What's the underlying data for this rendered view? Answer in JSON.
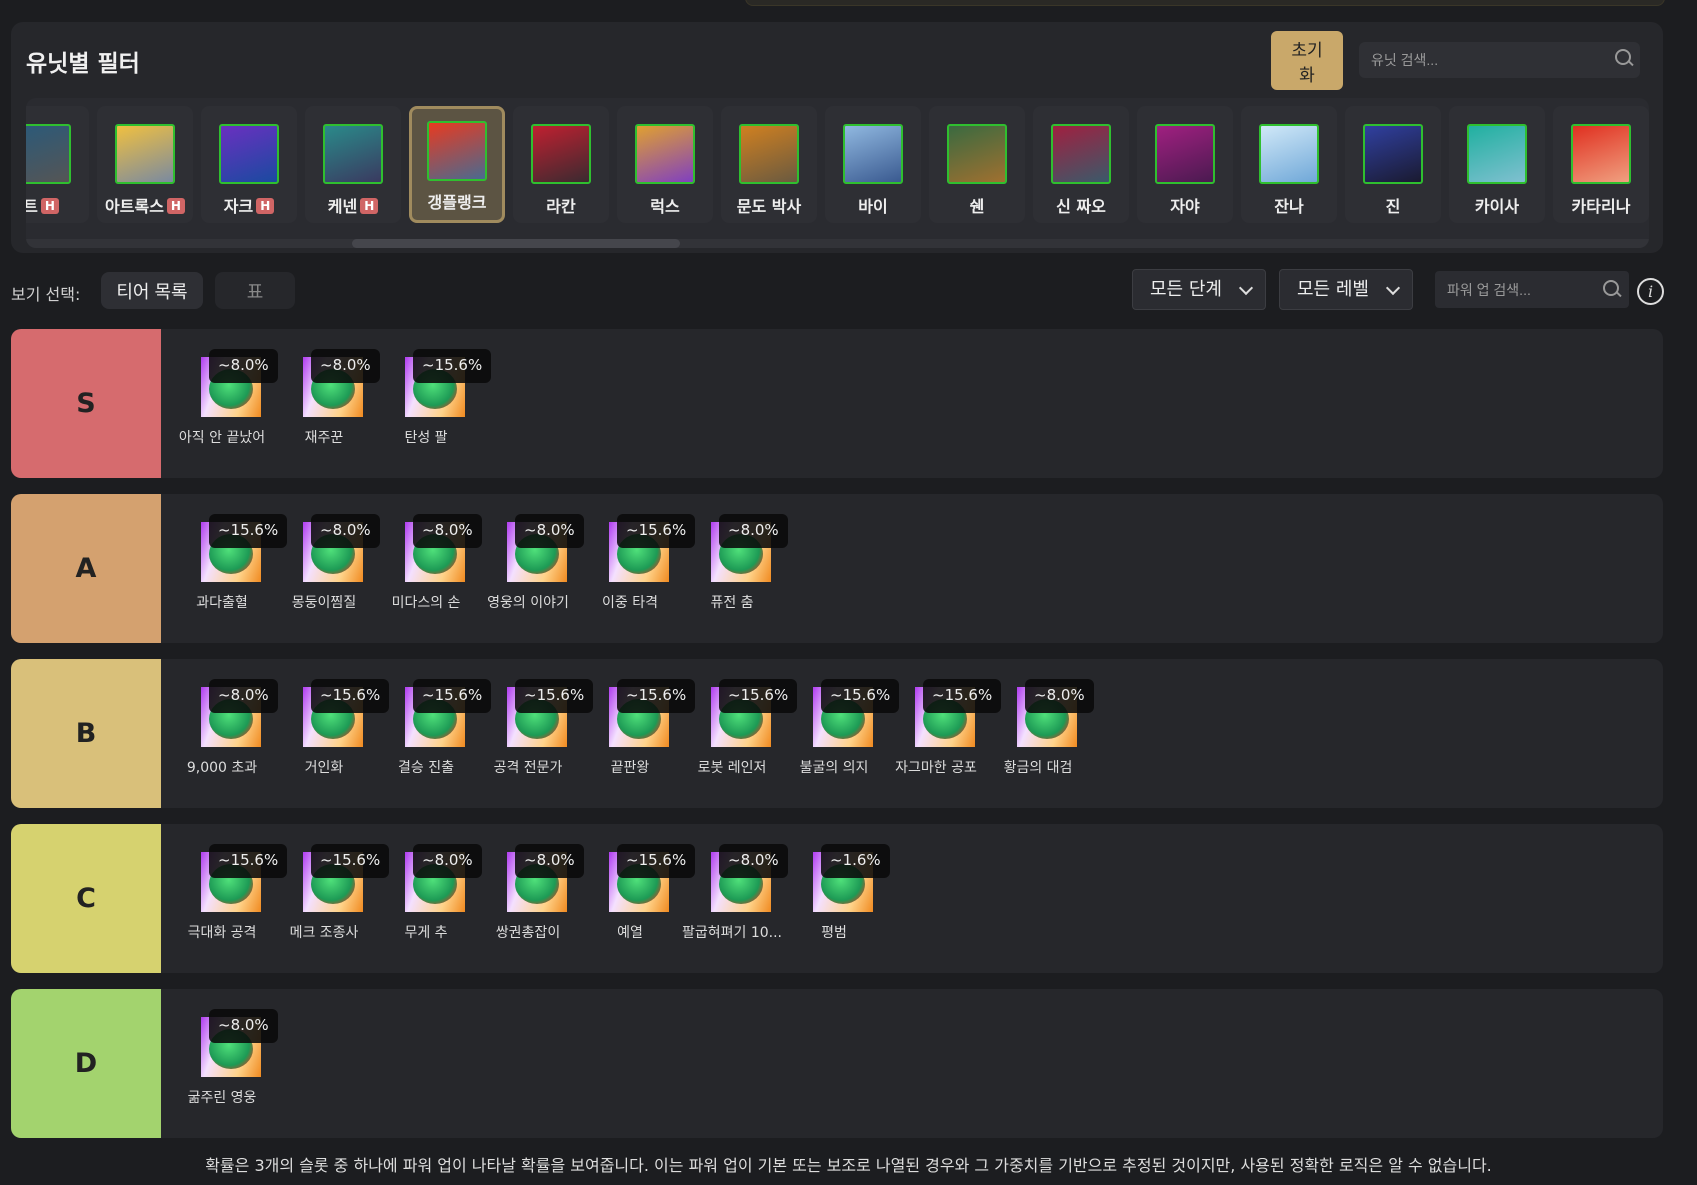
{
  "filter": {
    "title": "유닛별 필터",
    "reset_label": "초기\n화",
    "search_placeholder": "유닛 검색...",
    "units": [
      {
        "name": "트",
        "h": true,
        "colors": [
          "#2a5a7a",
          "#555"
        ]
      },
      {
        "name": "아트록스",
        "h": true,
        "colors": [
          "#f0c040",
          "#7a8aa0"
        ]
      },
      {
        "name": "자크",
        "h": true,
        "colors": [
          "#6a30c0",
          "#1a4aa0"
        ]
      },
      {
        "name": "케넨",
        "h": true,
        "colors": [
          "#2a8a8a",
          "#3a3a60"
        ]
      },
      {
        "name": "갱플랭크",
        "h": false,
        "selected": true,
        "colors": [
          "#e83a20",
          "#4a6a90"
        ]
      },
      {
        "name": "라칸",
        "h": false,
        "colors": [
          "#c02030",
          "#3a2a30"
        ]
      },
      {
        "name": "럭스",
        "h": false,
        "colors": [
          "#e0a030",
          "#8040c0"
        ]
      },
      {
        "name": "문도 박사",
        "h": false,
        "colors": [
          "#d08020",
          "#6a5a40"
        ]
      },
      {
        "name": "바이",
        "h": false,
        "colors": [
          "#90b8e0",
          "#3a5a90"
        ]
      },
      {
        "name": "쉔",
        "h": false,
        "colors": [
          "#3a6a40",
          "#a07030"
        ]
      },
      {
        "name": "신 짜오",
        "h": false,
        "colors": [
          "#a02040",
          "#3a5a6a"
        ]
      },
      {
        "name": "자야",
        "h": false,
        "colors": [
          "#a02080",
          "#4a1a50"
        ]
      },
      {
        "name": "잔나",
        "h": false,
        "colors": [
          "#d0e8f8",
          "#70a8d8"
        ]
      },
      {
        "name": "진",
        "h": false,
        "colors": [
          "#3040a0",
          "#1a1a30"
        ]
      },
      {
        "name": "카이사",
        "h": false,
        "colors": [
          "#20b0a0",
          "#80c0d0"
        ]
      },
      {
        "name": "카타리나",
        "h": false,
        "colors": [
          "#e03020",
          "#f0a080"
        ]
      }
    ]
  },
  "view": {
    "label": "보기 선택:",
    "tab_tier": "티어 목록",
    "tab_table": "표",
    "stage_select": "모든 단계",
    "level_select": "모든 레벨",
    "powerup_placeholder": "파워 업 검색...",
    "info": "i"
  },
  "tiers": [
    {
      "label": "S",
      "color": "#d66b6e",
      "items": [
        {
          "name": "아직 안 끝났어",
          "pct": "~8.0%"
        },
        {
          "name": "재주꾼",
          "pct": "~8.0%"
        },
        {
          "name": "탄성 팔",
          "pct": "~15.6%"
        }
      ]
    },
    {
      "label": "A",
      "color": "#d4a16f",
      "items": [
        {
          "name": "과다출혈",
          "pct": "~15.6%"
        },
        {
          "name": "몽둥이찜질",
          "pct": "~8.0%"
        },
        {
          "name": "미다스의 손",
          "pct": "~8.0%"
        },
        {
          "name": "영웅의 이야기",
          "pct": "~8.0%"
        },
        {
          "name": "이중 타격",
          "pct": "~15.6%"
        },
        {
          "name": "퓨전 춤",
          "pct": "~8.0%"
        }
      ]
    },
    {
      "label": "B",
      "color": "#d9c07a",
      "items": [
        {
          "name": "9,000 초과",
          "pct": "~8.0%"
        },
        {
          "name": "거인화",
          "pct": "~15.6%"
        },
        {
          "name": "결승 진출",
          "pct": "~15.6%"
        },
        {
          "name": "공격 전문가",
          "pct": "~15.6%"
        },
        {
          "name": "끝판왕",
          "pct": "~15.6%"
        },
        {
          "name": "로봇 레인저",
          "pct": "~15.6%"
        },
        {
          "name": "불굴의 의지",
          "pct": "~15.6%"
        },
        {
          "name": "자그마한 공포",
          "pct": "~15.6%"
        },
        {
          "name": "황금의 대검",
          "pct": "~8.0%"
        }
      ]
    },
    {
      "label": "C",
      "color": "#d6d26f",
      "items": [
        {
          "name": "극대화 공격",
          "pct": "~15.6%"
        },
        {
          "name": "메크 조종사",
          "pct": "~15.6%"
        },
        {
          "name": "무게 추",
          "pct": "~8.0%"
        },
        {
          "name": "쌍권총잡이",
          "pct": "~8.0%"
        },
        {
          "name": "예열",
          "pct": "~15.6%"
        },
        {
          "name": "팔굽혀펴기 10...",
          "pct": "~8.0%"
        },
        {
          "name": "평범",
          "pct": "~1.6%"
        }
      ]
    },
    {
      "label": "D",
      "color": "#a3d36e",
      "items": [
        {
          "name": "굶주린 영웅",
          "pct": "~8.0%"
        }
      ]
    }
  ],
  "footnote": "확률은 3개의 슬롯 중 하나에 파워 업이 나타날 확률을 보여줍니다. 이는 파워 업이 기본 또는 보조로 나열된 경우와 그 가중치를 기반으로 추정된 것이지만, 사용된 정확한 로직은 알 수 없습니다."
}
